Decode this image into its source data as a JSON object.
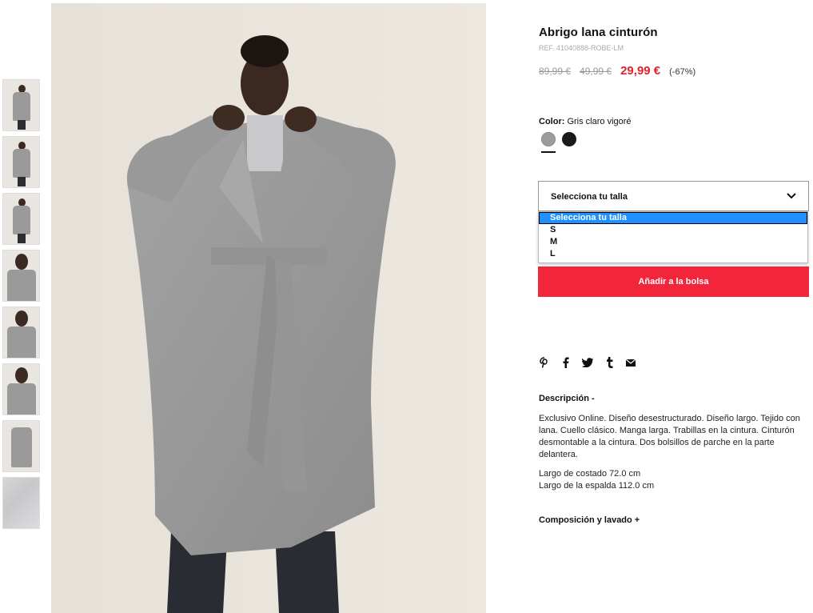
{
  "product": {
    "title": "Abrigo lana cinturón",
    "ref": "REF. 41040888-ROBE-LM",
    "prices": {
      "original_1": "89,99 €",
      "original_2": "49,99 €",
      "current": "29,99 €",
      "discount": "(-67%)"
    },
    "color": {
      "label": "Color:",
      "value": "Gris claro vigoré",
      "swatches": [
        {
          "name": "grey-swatch",
          "hex": "#9c9c9c",
          "selected": true
        },
        {
          "name": "black-swatch",
          "hex": "#1a1a1a",
          "selected": false
        }
      ]
    },
    "size_select": {
      "value": "Selecciona tu talla",
      "options": [
        "Selecciona tu talla",
        "S",
        "M",
        "L"
      ],
      "selected_index": 0
    },
    "add_button": "Añadir a la bolsa",
    "social_icons": [
      "pinterest-icon",
      "facebook-icon",
      "twitter-icon",
      "tumblr-icon",
      "mail-icon"
    ],
    "description": {
      "title": "Descripción  -",
      "text": "Exclusivo Online. Diseño desestructurado. Diseño largo. Tejido con lana. Cuello clásico. Manga larga. Trabillas en la cintura. Cinturón desmontable a la cintura. Dos bolsillos de parche en la parte delantera.",
      "measure_1": "Largo de costado 72.0 cm",
      "measure_2": "Largo de la espalda 112.0 cm"
    },
    "composition_title": "Composición y lavado  +"
  },
  "colors": {
    "accent_red": "#f2253a",
    "price_red": "#e4202f",
    "select_highlight": "#1e90ff"
  }
}
